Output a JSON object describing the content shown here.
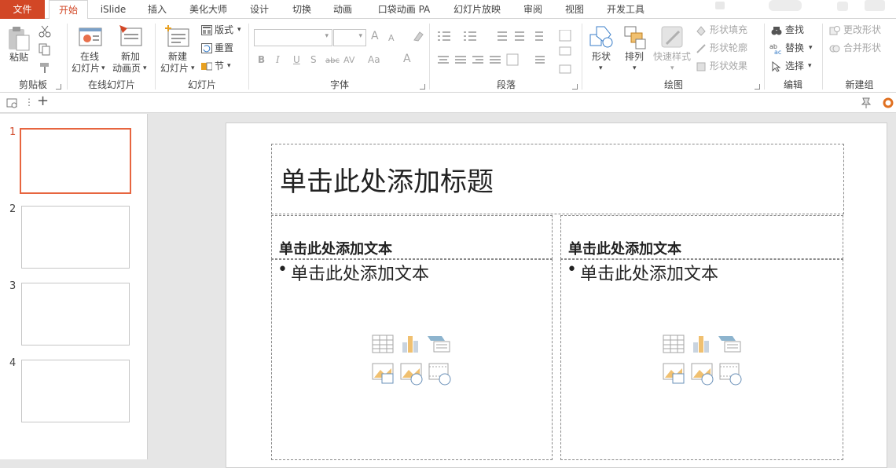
{
  "tabs": {
    "file": "文件",
    "home": "开始",
    "islide": "iSlide",
    "insert": "插入",
    "beautify": "美化大师",
    "design": "设计",
    "transitions": "切换",
    "animations": "动画",
    "pocket": "口袋动画 PA",
    "slideshow": "幻灯片放映",
    "review": "审阅",
    "view": "视图",
    "developer": "开发工具"
  },
  "clipboard": {
    "paste": "粘贴",
    "label": "剪贴板"
  },
  "online": {
    "online_slides_1": "在线",
    "online_slides_2": "幻灯片",
    "new_anim_1": "新加",
    "new_anim_2": "动画页",
    "label": "在线幻灯片"
  },
  "slides": {
    "new_1": "新建",
    "new_2": "幻灯片",
    "layout": "版式",
    "reset": "重置",
    "section": "节",
    "label": "幻灯片"
  },
  "font": {
    "label": "字体",
    "bold": "B",
    "italic": "I",
    "underline": "U",
    "shadow": "S",
    "strike": "abc",
    "spacing": "AV",
    "case": "Aa",
    "color": "A",
    "grow": "A",
    "shrink": "A"
  },
  "paragraph": {
    "label": "段落"
  },
  "drawing": {
    "shapes": "形状",
    "arrange": "排列",
    "quick_styles": "快速样式",
    "fill": "形状填充",
    "outline": "形状轮廓",
    "effects": "形状效果",
    "label": "绘图"
  },
  "editing": {
    "find": "查找",
    "replace": "替换",
    "select": "选择",
    "label": "编辑"
  },
  "newgroup": {
    "change_shape": "更改形状",
    "merge_shapes": "合并形状",
    "label": "新建组"
  },
  "slide_numbers": [
    "1",
    "2",
    "3",
    "4"
  ],
  "slide": {
    "title": "单击此处添加标题",
    "left_heading": "单击此处添加文本",
    "left_body": "单击此处添加文本",
    "right_heading": "单击此处添加文本",
    "right_body": "单击此处添加文本",
    "bullet": "•"
  },
  "colors": {
    "accent": "#d24726",
    "selection": "#e7653f"
  }
}
